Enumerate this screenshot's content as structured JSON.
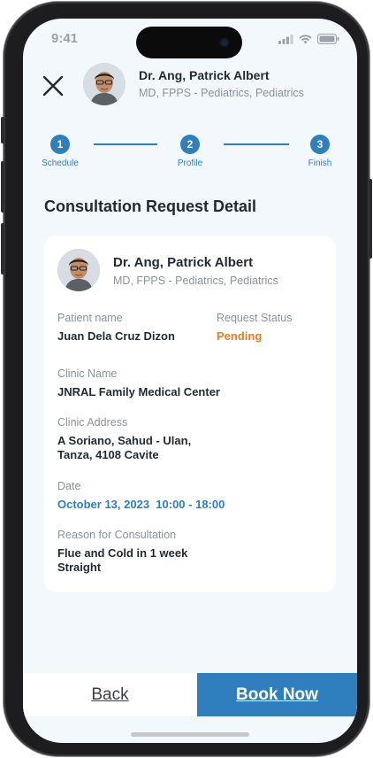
{
  "status_bar": {
    "time": "9:41"
  },
  "header": {
    "doctor_name": "Dr. Ang, Patrick Albert",
    "doctor_credentials": "MD, FPPS - Pediatrics, Pediatrics"
  },
  "stepper": {
    "steps": [
      {
        "number": "1",
        "label": "Schedule"
      },
      {
        "number": "2",
        "label": "Profile"
      },
      {
        "number": "3",
        "label": "Finish"
      }
    ]
  },
  "page_title": "Consultation Request Detail",
  "card": {
    "doctor_name": "Dr. Ang, Patrick Albert",
    "doctor_credentials": "MD, FPPS - Pediatrics, Pediatrics",
    "patient_name_label": "Patient name",
    "patient_name": "Juan Dela Cruz Dizon",
    "status_label": "Request Status",
    "status": "Pending",
    "clinic_name_label": "Clinic Name",
    "clinic_name": "JNRAL Family Medical Center",
    "clinic_address_label": "Clinic Address",
    "clinic_address_line1": "A Soriano, Sahud - Ulan,",
    "clinic_address_line2": "Tanza, 4108 Cavite",
    "date_label": "Date",
    "date_value": "October 13, 2023  10:00 - 18:00",
    "reason_label": "Reason for Consultation",
    "reason_line1": "Flue and Cold in 1 week",
    "reason_line2": "Straight"
  },
  "actions": {
    "back_label": "Back",
    "book_label": "Book Now"
  },
  "colors": {
    "primary": "#2f7fbe",
    "pending": "#f07a1e",
    "background": "#f2f8fc"
  },
  "icons": [
    "close-icon",
    "signal-icon",
    "wifi-icon",
    "battery-icon"
  ]
}
